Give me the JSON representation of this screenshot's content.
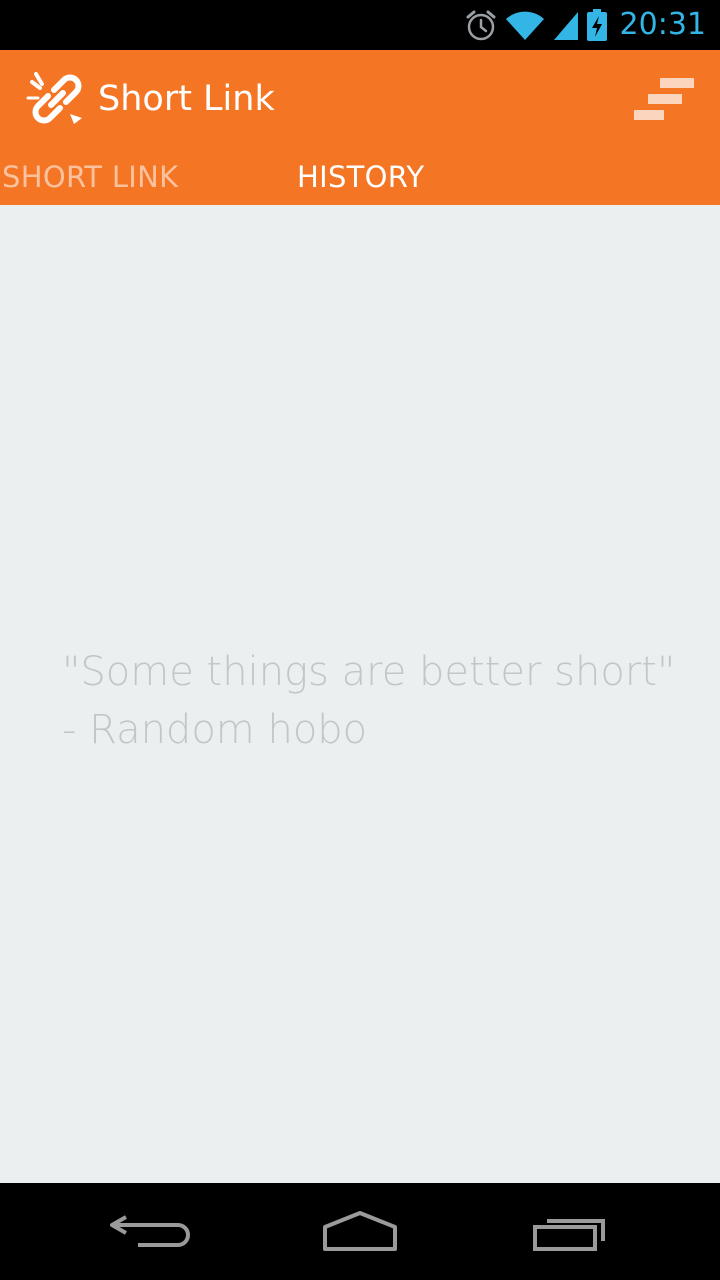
{
  "status_bar": {
    "time": "20:31",
    "icons": [
      "alarm-icon",
      "wifi-icon",
      "signal-icon",
      "battery-charging-icon"
    ],
    "accent_color": "#33b5e5"
  },
  "action_bar": {
    "title": "Short Link",
    "logo_icon": "broken-link-icon",
    "overflow_icon": "overflow-menu-icon",
    "background_color": "#f47524"
  },
  "tabs": [
    {
      "label": "SHORT LINK",
      "selected": false
    },
    {
      "label": "HISTORY",
      "selected": true
    }
  ],
  "empty_state": {
    "quote_line1": "\"Some things are better short\"",
    "quote_line2": "- Random hobo"
  },
  "nav_bar": {
    "buttons": [
      "back-icon",
      "home-icon",
      "recent-apps-icon"
    ]
  }
}
